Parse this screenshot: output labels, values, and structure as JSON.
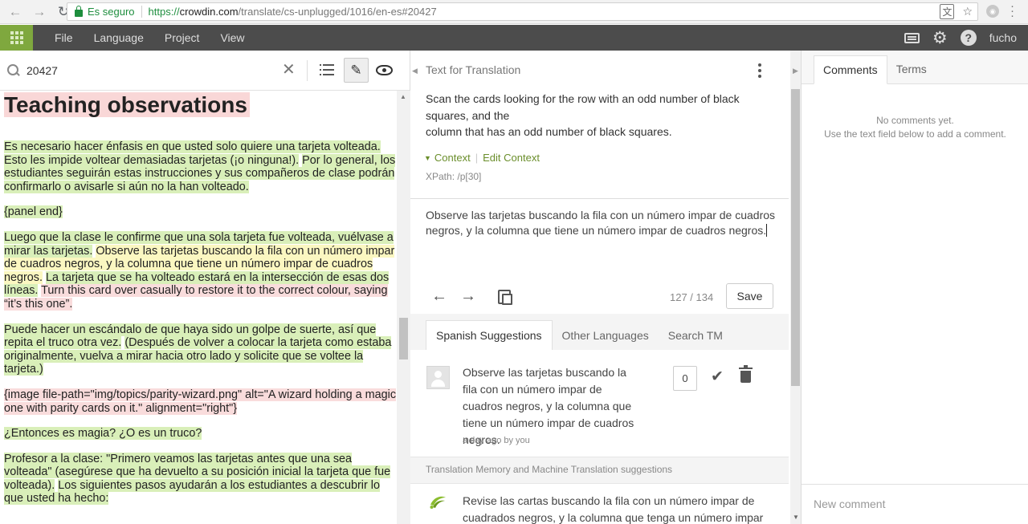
{
  "browser": {
    "secure_label": "Es seguro",
    "url_scheme": "https://",
    "url_host": "crowdin.com",
    "url_path": "/translate/cs-unplugged/1016/en-es#20427"
  },
  "app": {
    "menu": [
      "File",
      "Language",
      "Project",
      "View"
    ],
    "username": "fucho",
    "accent_color": "#7fa83e"
  },
  "search": {
    "value": "20427"
  },
  "document": {
    "heading": "Teaching observations",
    "paragraphs": [
      [
        {
          "t": "Es necesario hacer énfasis en que usted solo quiere una tarjeta volteada.",
          "c": "g"
        },
        {
          "t": " ",
          "c": ""
        },
        {
          "t": "Esto les impide voltear demasiadas tarjetas (¡o ninguna!).",
          "c": "g"
        },
        {
          "t": " ",
          "c": ""
        },
        {
          "t": "Por lo general, los estudiantes seguirán estas instrucciones y sus compañeros de clase podrán confirmarlo o avisarle si aún no la han volteado.",
          "c": "g"
        }
      ],
      [
        {
          "t": "{panel end}",
          "c": "g"
        }
      ],
      [
        {
          "t": "Luego que la clase le confirme que una sola tarjeta fue volteada, vuélvase a mirar las tarjetas.",
          "c": "g"
        },
        {
          "t": " ",
          "c": ""
        },
        {
          "t": "Observe las tarjetas buscando la fila con un número impar de cuadros negros, y la columna que tiene un número impar de cuadros negros.",
          "c": "y"
        },
        {
          "t": " ",
          "c": ""
        },
        {
          "t": "La tarjeta que se ha volteado estará en la intersección de esas dos líneas.",
          "c": "g"
        },
        {
          "t": " ",
          "c": ""
        },
        {
          "t": "Turn this card over casually to restore it to the correct colour, saying “it’s this one”.",
          "c": "r"
        }
      ],
      [
        {
          "t": "Puede hacer un escándalo de que haya sido un golpe de suerte, así que repita el truco otra vez.",
          "c": "g"
        },
        {
          "t": " ",
          "c": ""
        },
        {
          "t": "(Después de volver a colocar la tarjeta como estaba originalmente, vuelva a mirar hacia otro lado y solicite que se voltee la tarjeta.)",
          "c": "g"
        }
      ],
      [
        {
          "t": "{image file-path=\"img/topics/parity-wizard.png\" alt=\"A wizard holding a magic one with parity cards on it.\" alignment=\"right\"}",
          "c": "r"
        }
      ],
      [
        {
          "t": "¿Entonces es magia? ¿O es un truco?",
          "c": "g"
        }
      ],
      [
        {
          "t": "Profesor a la clase: \"Primero veamos las tarjetas antes que una sea volteada\" (asegúrese que ha devuelto a su posición inicial la tarjeta que fue volteada).",
          "c": "g"
        },
        {
          "t": " ",
          "c": ""
        },
        {
          "t": "Los siguientes pasos ayudarán a los estudiantes a descubrir lo que usted ha hecho:",
          "c": "g"
        }
      ]
    ]
  },
  "editor": {
    "header": "Text for Translation",
    "source_lines": [
      "Scan the cards looking for the row with an odd number of black squares, and the",
      "column that has an odd number of black squares."
    ],
    "context_label": "Context",
    "edit_context_label": "Edit Context",
    "xpath": "XPath: /p[30]",
    "translation": "Observe las tarjetas buscando la fila con un número impar de cuadros negros, y la columna que tiene un número impar de cuadros negros.",
    "counter": "127 / 134",
    "save_label": "Save"
  },
  "suggestions": {
    "tabs": [
      "Spanish Suggestions",
      "Other Languages",
      "Search TM"
    ],
    "item": {
      "text": "Observe las tarjetas buscando la fila con un número impar de cuadros negros, y la columna que tiene un número impar de cuadros negros.",
      "meta": "a day ago by you",
      "votes": "0"
    },
    "tm_label": "Translation Memory and Machine Translation suggestions",
    "tm_text": "Revise las cartas buscando la fila con un número impar de cuadrados negros, y la columna que tenga un número impar"
  },
  "comments": {
    "tabs": [
      "Comments",
      "Terms"
    ],
    "empty_line1": "No comments yet.",
    "empty_line2": "Use the text field below to add a comment.",
    "placeholder": "New comment"
  }
}
